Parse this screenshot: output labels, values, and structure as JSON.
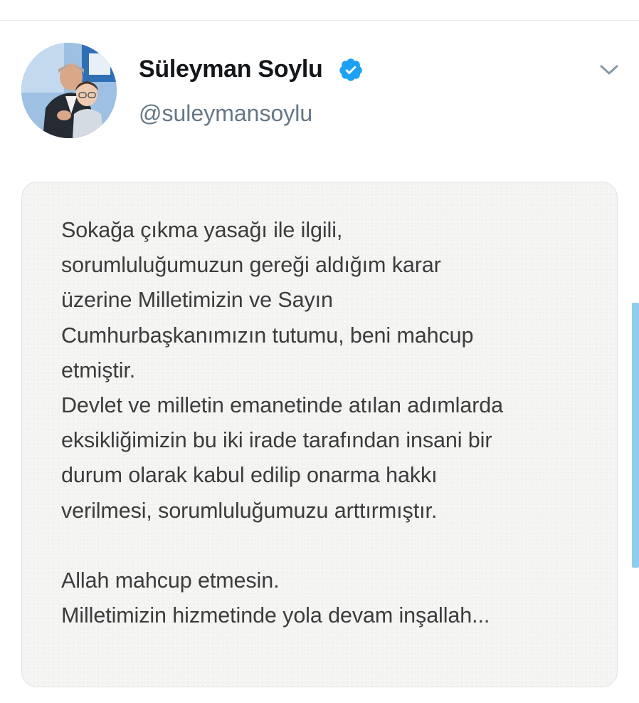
{
  "tweet": {
    "author": {
      "display_name": "Süleyman Soylu",
      "handle": "@suleymansoylu",
      "verified": true,
      "verified_color": "#1da1f2"
    },
    "menu_icon": "chevron-down-icon",
    "media": {
      "lines": [
        "Sokağa çıkma yasağı ile ilgili,",
        "sorumluluğumuzun gereği aldığım karar",
        "üzerine Milletimizin ve Sayın",
        "Cumhurbaşkanımızın tutumu, beni mahcup",
        "etmiştir.",
        "Devlet ve milletin emanetinde atılan adımlarda",
        "eksikliğimizin bu iki irade tarafından insani bir",
        "durum olarak kabul edilip onarma hakkı",
        "verilmesi, sorumluluğumuzu arttırmıştır.",
        "Allah mahcup etmesin.",
        "Milletimizin hizmetinde yola devam inşallah..."
      ]
    }
  },
  "colors": {
    "handle": "#657786",
    "divider": "#e1e8ed",
    "scroll_indicator": "#8fcdf0"
  }
}
